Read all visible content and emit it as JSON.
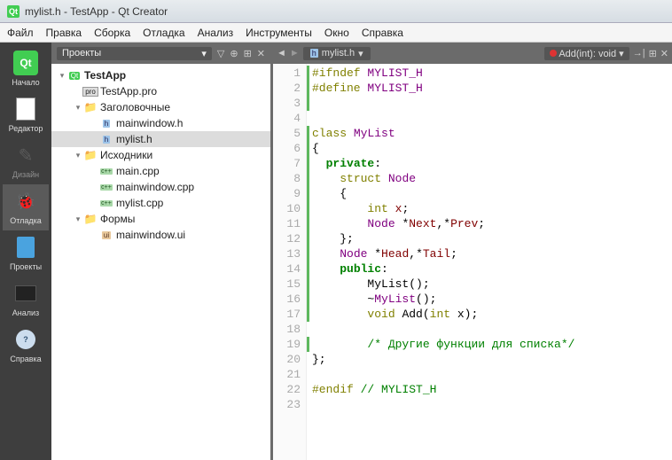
{
  "window": {
    "title": "mylist.h - TestApp - Qt Creator"
  },
  "menu": [
    "Файл",
    "Правка",
    "Сборка",
    "Отладка",
    "Анализ",
    "Инструменты",
    "Окно",
    "Справка"
  ],
  "modes": [
    {
      "label": "Начало",
      "icon": "qt"
    },
    {
      "label": "Редактор",
      "icon": "doc",
      "selected": false
    },
    {
      "label": "Дизайн",
      "icon": "design",
      "dim": true
    },
    {
      "label": "Отладка",
      "icon": "debug",
      "selected": true
    },
    {
      "label": "Проекты",
      "icon": "proj"
    },
    {
      "label": "Анализ",
      "icon": "anal"
    },
    {
      "label": "Справка",
      "icon": "help"
    }
  ],
  "projectsHeader": {
    "selector": "Проекты",
    "icons": [
      "filter",
      "add",
      "split",
      "close"
    ]
  },
  "tree": [
    {
      "d": 0,
      "ic": "qt",
      "t": "TestApp",
      "exp": true,
      "bold": true
    },
    {
      "d": 1,
      "ic": "pro",
      "t": "TestApp.pro"
    },
    {
      "d": 1,
      "ic": "fld",
      "t": "Заголовочные",
      "exp": true
    },
    {
      "d": 2,
      "ic": "h",
      "t": "mainwindow.h"
    },
    {
      "d": 2,
      "ic": "h",
      "t": "mylist.h",
      "sel": true
    },
    {
      "d": 1,
      "ic": "fld",
      "t": "Исходники",
      "exp": true
    },
    {
      "d": 2,
      "ic": "cpp",
      "t": "main.cpp"
    },
    {
      "d": 2,
      "ic": "cpp",
      "t": "mainwindow.cpp"
    },
    {
      "d": 2,
      "ic": "cpp",
      "t": "mylist.cpp"
    },
    {
      "d": 1,
      "ic": "fld",
      "t": "Формы",
      "exp": true
    },
    {
      "d": 2,
      "ic": "ui",
      "t": "mainwindow.ui"
    }
  ],
  "editorBar": {
    "nav": [
      "back",
      "fwd"
    ],
    "file": "mylist.h",
    "symbol": "Add(int): void",
    "right": [
      "line",
      "split",
      "close"
    ]
  },
  "code": [
    {
      "n": 1,
      "mk": true,
      "h": "<span class='kw-o'>#ifndef</span> <span class='kw-pr'>MYLIST_H</span>"
    },
    {
      "n": 2,
      "mk": true,
      "h": "<span class='kw-o'>#define</span> <span class='kw-pr'>MYLIST_H</span>"
    },
    {
      "n": 3,
      "mk": true,
      "h": ""
    },
    {
      "n": 4,
      "h": ""
    },
    {
      "n": 5,
      "mk": true,
      "fold": true,
      "h": "<span class='kw-o'>class</span> <span class='kw-pr'>MyList</span>"
    },
    {
      "n": 6,
      "mk": true,
      "h": "{"
    },
    {
      "n": 7,
      "mk": true,
      "h": "  <span class='kw-g'>private</span>:"
    },
    {
      "n": 8,
      "mk": true,
      "fold": true,
      "h": "    <span class='kw-o'>struct</span> <span class='kw-pr'>Node</span>"
    },
    {
      "n": 9,
      "mk": true,
      "h": "    {"
    },
    {
      "n": 10,
      "mk": true,
      "h": "        <span class='kw-o'>int</span> <span class='kw-m'>x</span>;"
    },
    {
      "n": 11,
      "mk": true,
      "h": "        <span class='kw-pr'>Node</span> *<span class='kw-m'>Next</span>,*<span class='kw-m'>Prev</span>;"
    },
    {
      "n": 12,
      "mk": true,
      "h": "    };"
    },
    {
      "n": 13,
      "mk": true,
      "h": "    <span class='kw-pr'>Node</span> *<span class='kw-m'>Head</span>,*<span class='kw-m'>Tail</span>;"
    },
    {
      "n": 14,
      "mk": true,
      "h": "    <span class='kw-g'>public</span>:"
    },
    {
      "n": 15,
      "mk": true,
      "h": "        <span class='nm'>MyList</span>();"
    },
    {
      "n": 16,
      "mk": true,
      "h": "        ~<span class='kw-pr'>MyList</span>();"
    },
    {
      "n": 17,
      "mk": true,
      "h": "        <span class='kw-o'>void</span> <span class='nm'>Add</span>(<span class='kw-o'>int</span> x);"
    },
    {
      "n": 18,
      "h": ""
    },
    {
      "n": 19,
      "mk": true,
      "h": "        <span class='kw-cm'>/* Другие функции для списка*/</span>"
    },
    {
      "n": 20,
      "h": "};"
    },
    {
      "n": 21,
      "h": ""
    },
    {
      "n": 22,
      "h": "<span class='kw-o'>#endif</span> <span class='kw-cm'>// MYLIST_H</span>"
    },
    {
      "n": 23,
      "h": ""
    }
  ]
}
